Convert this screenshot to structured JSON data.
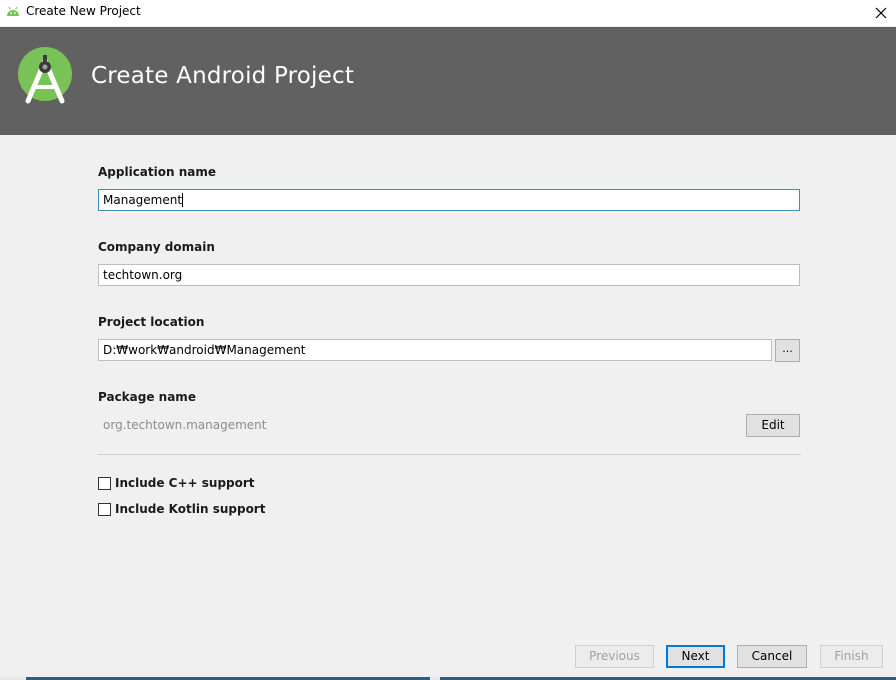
{
  "window": {
    "title": "Create New Project"
  },
  "header": {
    "title": "Create Android Project"
  },
  "form": {
    "application_name": {
      "label": "Application name",
      "value": "Management"
    },
    "company_domain": {
      "label": "Company domain",
      "value": "techtown.org"
    },
    "project_location": {
      "label": "Project location",
      "value": "D:₩work₩android₩Management",
      "browse_label": "..."
    },
    "package_name": {
      "label": "Package name",
      "value": "org.techtown.management",
      "edit_label": "Edit"
    },
    "options": [
      {
        "label": "Include C++ support",
        "checked": false
      },
      {
        "label": "Include Kotlin support",
        "checked": false
      }
    ]
  },
  "footer": {
    "previous_label": "Previous",
    "next_label": "Next",
    "cancel_label": "Cancel",
    "finish_label": "Finish"
  },
  "icons": {
    "window_icon": "android-icon",
    "logo": "android-studio-logo",
    "close": "close-icon"
  },
  "colors": {
    "header_bg": "#616161",
    "logo_green": "#78c257",
    "focus_border": "#3d8fb5",
    "primary_button_border": "#0078d7"
  }
}
